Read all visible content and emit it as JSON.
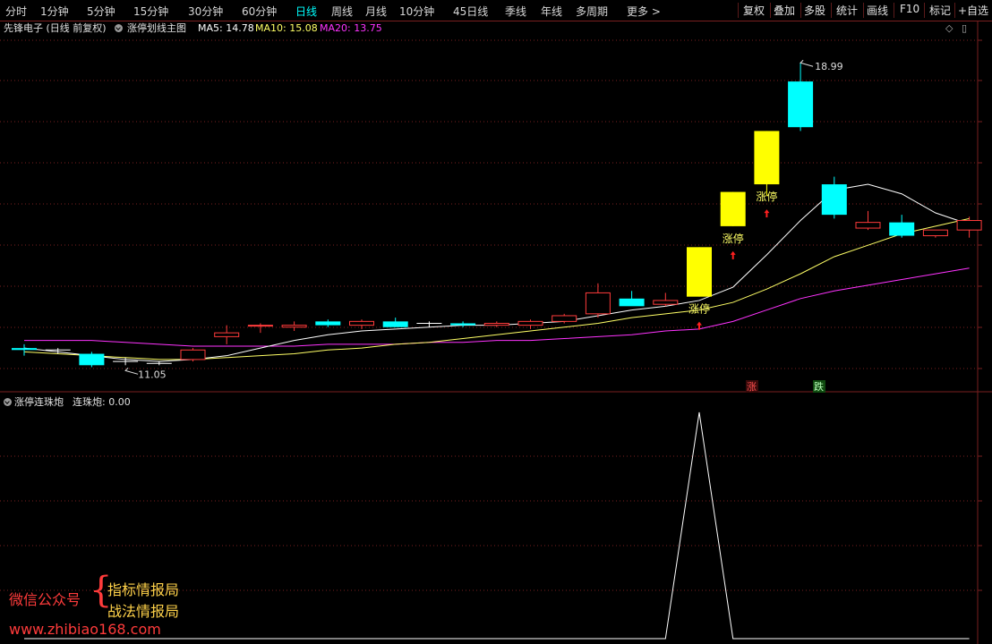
{
  "toolbar": {
    "timeframes": [
      "分时",
      "1分钟",
      "5分钟",
      "15分钟",
      "30分钟",
      "60分钟",
      "日线",
      "周线",
      "月线",
      "10分钟",
      "45日线",
      "季线",
      "年线",
      "多周期",
      "更多 >"
    ],
    "active": "日线",
    "right_buttons": [
      "复权",
      "叠加",
      "多股",
      "统计",
      "画线",
      "F10",
      "标记",
      "+自选"
    ]
  },
  "main_info": {
    "stock": "先锋电子 (日线 前复权)",
    "indicator": "涨停划线主图",
    "ma5": "MA5: 14.78",
    "ma10": "MA10: 15.08",
    "ma20": "MA20: 13.75"
  },
  "sub_info": {
    "indicator": "涨停连珠炮",
    "value": "连珠炮: 0.00"
  },
  "colors": {
    "up": "#ff3b3b",
    "down": "#00ffff",
    "limit_up": "#ffff00",
    "ma5": "#ffffff",
    "ma10": "#ffff66",
    "ma20": "#ff33ff",
    "grid": "#7a1f1f"
  },
  "price_scale": {
    "min": 10.4,
    "max": 19.7
  },
  "candles": [
    {
      "o": 11.5,
      "h": 11.6,
      "l": 11.3,
      "c": 11.45,
      "t": "down"
    },
    {
      "o": 11.45,
      "h": 11.5,
      "l": 11.35,
      "c": 11.45,
      "t": "flat"
    },
    {
      "o": 11.35,
      "h": 11.4,
      "l": 11.0,
      "c": 11.05,
      "t": "down"
    },
    {
      "o": 11.1,
      "h": 11.25,
      "l": 11.05,
      "c": 11.15,
      "t": "flat"
    },
    {
      "o": 11.1,
      "h": 11.15,
      "l": 11.05,
      "c": 11.1,
      "t": "flat"
    },
    {
      "o": 11.2,
      "h": 11.5,
      "l": 11.15,
      "c": 11.45,
      "t": "up"
    },
    {
      "o": 11.8,
      "h": 12.1,
      "l": 11.6,
      "c": 11.9,
      "t": "up"
    },
    {
      "o": 12.1,
      "h": 12.15,
      "l": 11.9,
      "c": 12.1,
      "t": "up"
    },
    {
      "o": 12.05,
      "h": 12.2,
      "l": 11.95,
      "c": 12.1,
      "t": "up"
    },
    {
      "o": 12.2,
      "h": 12.25,
      "l": 12.05,
      "c": 12.1,
      "t": "down"
    },
    {
      "o": 12.1,
      "h": 12.25,
      "l": 12.0,
      "c": 12.2,
      "t": "up"
    },
    {
      "o": 12.2,
      "h": 12.3,
      "l": 12.05,
      "c": 12.05,
      "t": "down"
    },
    {
      "o": 12.15,
      "h": 12.2,
      "l": 12.05,
      "c": 12.15,
      "t": "flat"
    },
    {
      "o": 12.15,
      "h": 12.2,
      "l": 12.05,
      "c": 12.1,
      "t": "down"
    },
    {
      "o": 12.1,
      "h": 12.2,
      "l": 12.05,
      "c": 12.15,
      "t": "up"
    },
    {
      "o": 12.1,
      "h": 12.25,
      "l": 12.0,
      "c": 12.2,
      "t": "up"
    },
    {
      "o": 12.2,
      "h": 12.4,
      "l": 12.15,
      "c": 12.35,
      "t": "up"
    },
    {
      "o": 12.4,
      "h": 13.2,
      "l": 12.3,
      "c": 12.95,
      "t": "up"
    },
    {
      "o": 12.8,
      "h": 13.0,
      "l": 12.7,
      "c": 12.6,
      "t": "down"
    },
    {
      "o": 12.65,
      "h": 12.95,
      "l": 12.6,
      "c": 12.75,
      "t": "up"
    },
    {
      "o": 12.85,
      "h": 14.15,
      "l": 12.85,
      "c": 14.15,
      "t": "limit",
      "label": "涨停"
    },
    {
      "o": 14.7,
      "h": 15.6,
      "l": 14.7,
      "c": 15.6,
      "t": "limit",
      "label": "涨停"
    },
    {
      "o": 15.8,
      "h": 17.2,
      "l": 15.5,
      "c": 17.2,
      "t": "limit",
      "label": "涨停"
    },
    {
      "o": 17.3,
      "h": 18.99,
      "l": 17.2,
      "c": 18.5,
      "t": "down"
    },
    {
      "o": 15.8,
      "h": 16.0,
      "l": 14.9,
      "c": 15.0,
      "t": "down"
    },
    {
      "o": 14.8,
      "h": 15.1,
      "l": 14.6,
      "c": 14.65,
      "t": "up"
    },
    {
      "o": 14.8,
      "h": 15.0,
      "l": 14.4,
      "c": 14.45,
      "t": "down"
    },
    {
      "o": 14.45,
      "h": 14.6,
      "l": 14.4,
      "c": 14.6,
      "t": "up"
    },
    {
      "o": 14.6,
      "h": 14.95,
      "l": 14.4,
      "c": 14.85,
      "t": "up"
    }
  ],
  "ma5_line": [
    11.5,
    11.4,
    11.3,
    11.2,
    11.15,
    11.2,
    11.3,
    11.5,
    11.7,
    11.85,
    11.95,
    12.0,
    12.05,
    12.1,
    12.1,
    12.15,
    12.2,
    12.35,
    12.5,
    12.6,
    12.75,
    13.1,
    13.95,
    14.85,
    15.65,
    15.8,
    15.55,
    15.05,
    14.75
  ],
  "ma10_line": [
    11.4,
    11.35,
    11.3,
    11.25,
    11.2,
    11.2,
    11.25,
    11.3,
    11.35,
    11.45,
    11.5,
    11.6,
    11.65,
    11.75,
    11.85,
    11.95,
    12.05,
    12.15,
    12.3,
    12.4,
    12.5,
    12.7,
    13.05,
    13.45,
    13.9,
    14.2,
    14.5,
    14.7,
    14.9
  ],
  "ma20_line": [
    11.7,
    11.7,
    11.7,
    11.65,
    11.6,
    11.55,
    11.55,
    11.55,
    11.55,
    11.6,
    11.6,
    11.6,
    11.65,
    11.65,
    11.7,
    11.7,
    11.75,
    11.8,
    11.85,
    11.95,
    12.0,
    12.2,
    12.5,
    12.8,
    13.0,
    13.15,
    13.3,
    13.45,
    13.6
  ],
  "annotations": {
    "high_label": "18.99",
    "low_label": "11.05",
    "up_tag": "涨",
    "down_tag": "跌"
  },
  "sub_series": [
    0,
    0,
    0,
    0,
    0,
    0,
    0,
    0,
    0,
    0,
    0,
    0,
    0,
    0,
    0,
    0,
    0,
    0,
    0,
    0,
    3,
    0,
    0,
    0,
    0,
    0,
    0,
    0,
    0
  ],
  "watermark": {
    "account": "微信公众号",
    "line1": "指标情报局",
    "line2": "战法情报局",
    "site": "www.zhibiao168.com"
  }
}
